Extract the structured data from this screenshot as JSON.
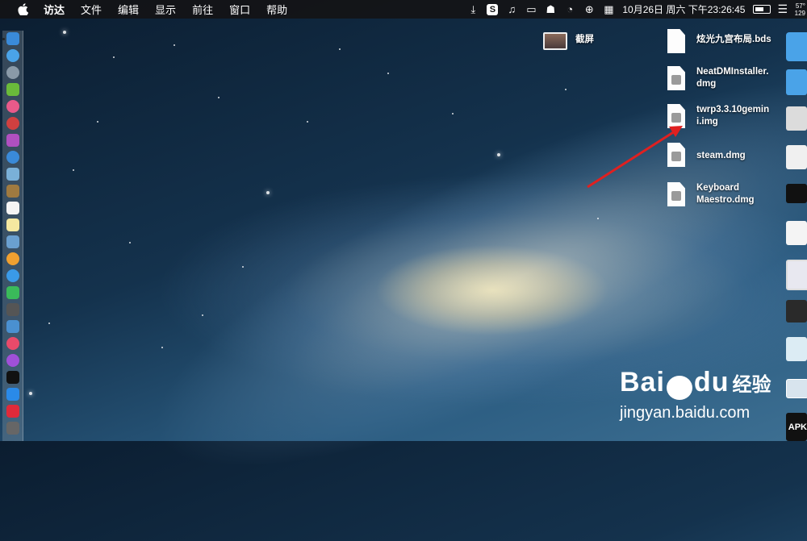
{
  "menubar": {
    "apple_icon": "apple-icon",
    "items": [
      "访达",
      "文件",
      "编辑",
      "显示",
      "前往",
      "窗口",
      "帮助"
    ],
    "status": {
      "icons": [
        "download-icon",
        "sogou-icon",
        "music-icon",
        "display-icon",
        "ghost-icon",
        "speedometer-icon",
        "globe-icon",
        "calendar-icon"
      ],
      "clock": "10月26日 周六 下午23:26:45",
      "temp_top": "57°",
      "temp_bottom": "129"
    }
  },
  "desktop": {
    "items": [
      {
        "label": "截屏",
        "type": "screenshot"
      },
      {
        "label": "炫光九宫布局.bds",
        "type": "file"
      },
      {
        "label": "NeatDMInstaller.\ndmg",
        "type": "dmg"
      },
      {
        "label": "twrp3.3.10gemin\ni.img",
        "type": "dmg"
      },
      {
        "label": "steam.dmg",
        "type": "dmg"
      },
      {
        "label": "Keyboard\nMaestro.dmg",
        "type": "dmg"
      }
    ],
    "partial_right_label": "APK"
  },
  "watermark": {
    "brand_left": "Bai",
    "brand_right": "经验",
    "brand_mid": "du",
    "url": "jingyan.baidu.com"
  },
  "annotation": {
    "color": "#e02020"
  }
}
